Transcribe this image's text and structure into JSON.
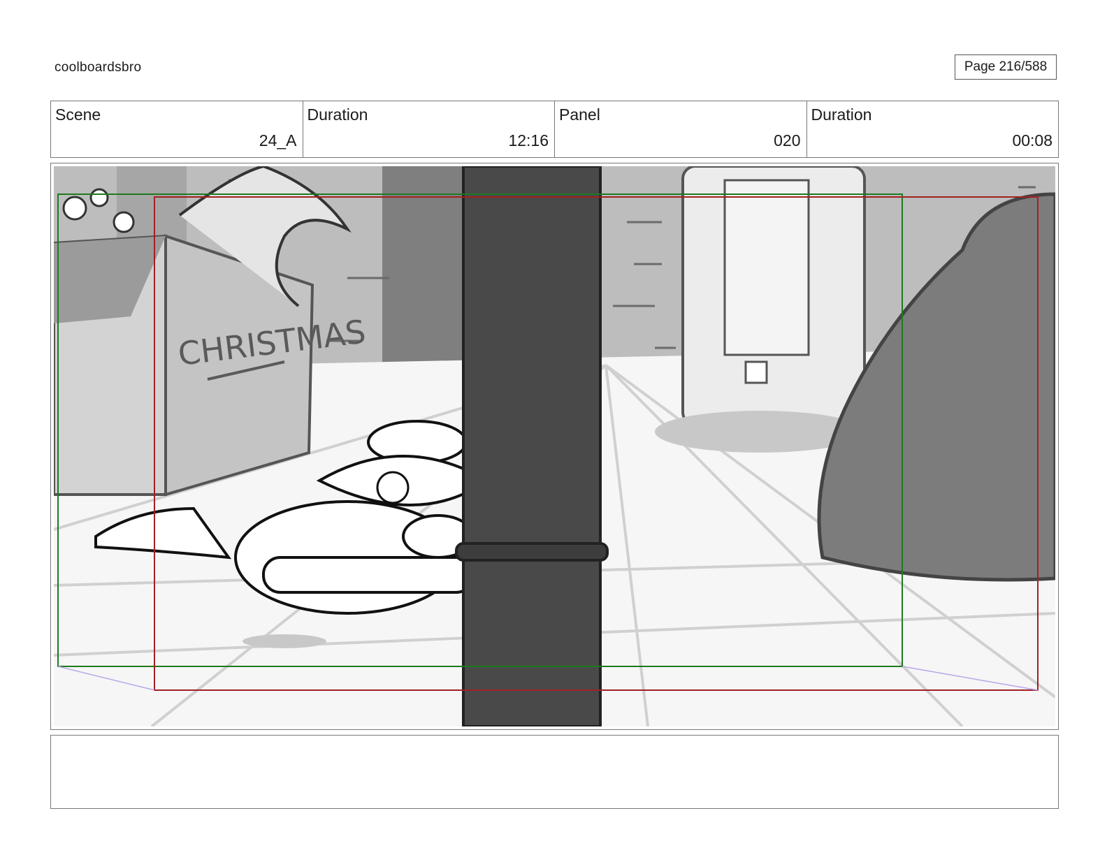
{
  "header": {
    "brand": "coolboardsbro",
    "page_label": "Page 216/588"
  },
  "info": {
    "scene_label": "Scene",
    "scene_value": "24_A",
    "scene_duration_label": "Duration",
    "scene_duration_value": "12:16",
    "panel_label": "Panel",
    "panel_value": "020",
    "panel_duration_label": "Duration",
    "panel_duration_value": "00:08"
  },
  "sketch": {
    "box_text": "CHRISTMAS",
    "safe_frame_color": "#1e7a1e",
    "camera_frame_color": "#a32020"
  },
  "notes": {
    "text": ""
  }
}
